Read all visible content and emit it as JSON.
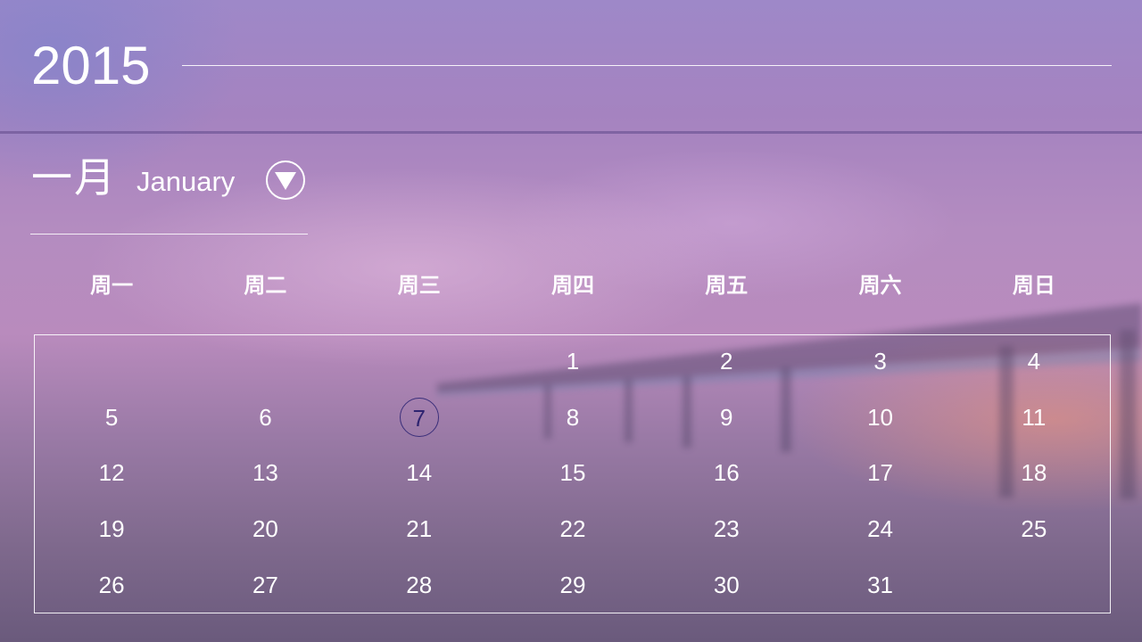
{
  "header": {
    "year": "2015",
    "month_cn": "一月",
    "month_en": "January",
    "toggle_icon": "chevron-down-icon"
  },
  "calendar": {
    "weekdays": [
      "周一",
      "周二",
      "周三",
      "周四",
      "周五",
      "周六",
      "周日"
    ],
    "leading_blanks": 3,
    "days": [
      "1",
      "2",
      "3",
      "4",
      "5",
      "6",
      "7",
      "8",
      "9",
      "10",
      "11",
      "12",
      "13",
      "14",
      "15",
      "16",
      "17",
      "18",
      "19",
      "20",
      "21",
      "22",
      "23",
      "24",
      "25",
      "26",
      "27",
      "28",
      "29",
      "30",
      "31"
    ],
    "highlighted_day": "7"
  },
  "colors": {
    "text": "#ffffff",
    "highlight_ring": "#3a2e7a",
    "highlight_text": "#2e2470",
    "band_line": "#6e5596"
  }
}
